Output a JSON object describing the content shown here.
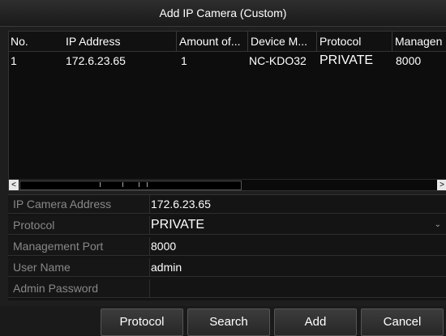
{
  "dialog": {
    "title": "Add IP Camera (Custom)"
  },
  "table": {
    "headers": [
      "No.",
      "IP Address",
      "Amount of...",
      "Device M...",
      "Protocol",
      "Managen"
    ],
    "rows": [
      [
        "1",
        "172.6.23.65",
        "1",
        "NC-KDO32",
        "PRIVATE",
        "8000"
      ]
    ],
    "scroll_left": "<",
    "scroll_right": ">"
  },
  "form": {
    "ip_label": "IP Camera Address",
    "ip_value": "172.6.23.65",
    "protocol_label": "Protocol",
    "protocol_value": "PRIVATE",
    "port_label": "Management Port",
    "port_value": "8000",
    "user_label": "User Name",
    "user_value": "admin",
    "password_label": "Admin Password",
    "password_value": ""
  },
  "buttons": {
    "protocol": "Protocol",
    "search": "Search",
    "add": "Add",
    "cancel": "Cancel"
  }
}
